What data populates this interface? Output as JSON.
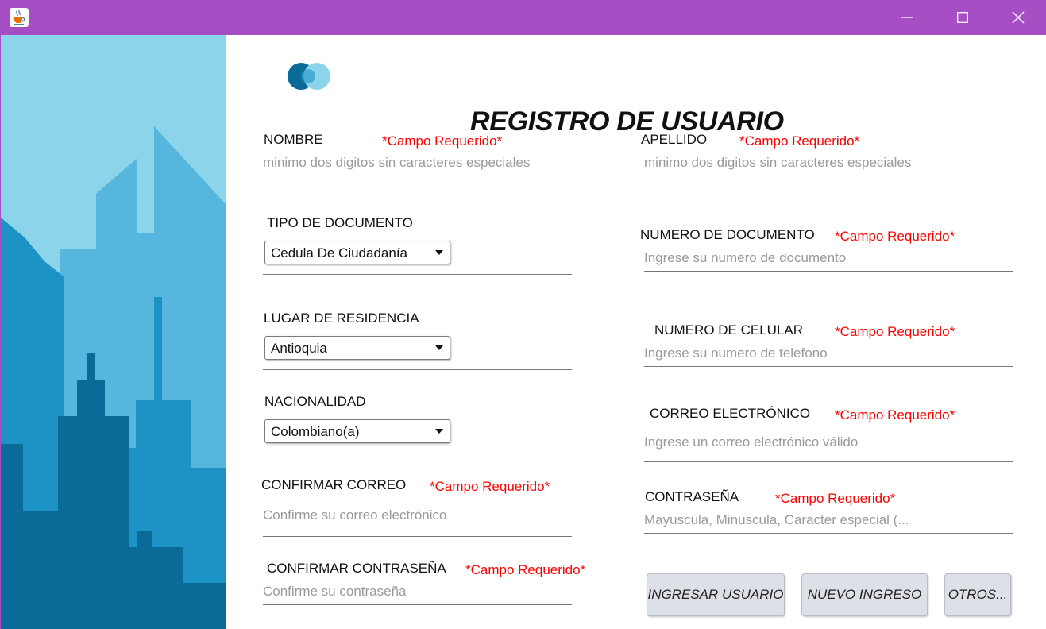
{
  "window": {
    "title": ""
  },
  "header": {
    "title": "REGISTRO DE USUARIO"
  },
  "required_text": "*Campo Requerido*",
  "fields": {
    "nombre": {
      "label": "NOMBRE",
      "placeholder": "minimo dos digitos sin caracteres especiales"
    },
    "apellido": {
      "label": "APELLIDO",
      "placeholder": "minimo dos digitos sin caracteres especiales"
    },
    "tipo_documento": {
      "label": "TIPO DE DOCUMENTO",
      "value": "Cedula De Ciudadanía"
    },
    "numero_documento": {
      "label": "NUMERO DE DOCUMENTO",
      "placeholder": "Ingrese su numero de documento"
    },
    "lugar_residencia": {
      "label": "LUGAR DE RESIDENCIA",
      "value": "Antioquia"
    },
    "numero_celular": {
      "label": "NUMERO DE CELULAR",
      "placeholder": "Ingrese su numero de telefono"
    },
    "nacionalidad": {
      "label": "NACIONALIDAD",
      "value": "Colombiano(a)"
    },
    "correo": {
      "label": "CORREO ELECTRÓNICO",
      "placeholder": "Ingrese un correo electrónico válido"
    },
    "confirmar_correo": {
      "label": "CONFIRMAR CORREO",
      "placeholder": "Confirme su correo electrónico"
    },
    "contrasena": {
      "label": "CONTRASEÑA",
      "placeholder": "Mayuscula, Minuscula, Caracter especial (..."
    },
    "confirmar_contrasena": {
      "label": "CONFIRMAR CONTRASEÑA",
      "placeholder": "Confirme su contraseña"
    }
  },
  "buttons": {
    "ingresar": "INGRESAR USUARIO",
    "nuevo": "NUEVO INGRESO",
    "otros": "OTROS..."
  },
  "colors": {
    "titlebar": "#a64ec4",
    "required": "#ff0000",
    "sky": "#8bd4ea",
    "building_light": "#56b6dd",
    "building_mid": "#1d92c5",
    "building_dark": "#0a6b99"
  },
  "icons": {
    "app": "java-cup-icon",
    "minimize": "minimize-icon",
    "maximize": "maximize-icon",
    "close": "close-icon",
    "logo": "overlapping-circles-logo"
  }
}
